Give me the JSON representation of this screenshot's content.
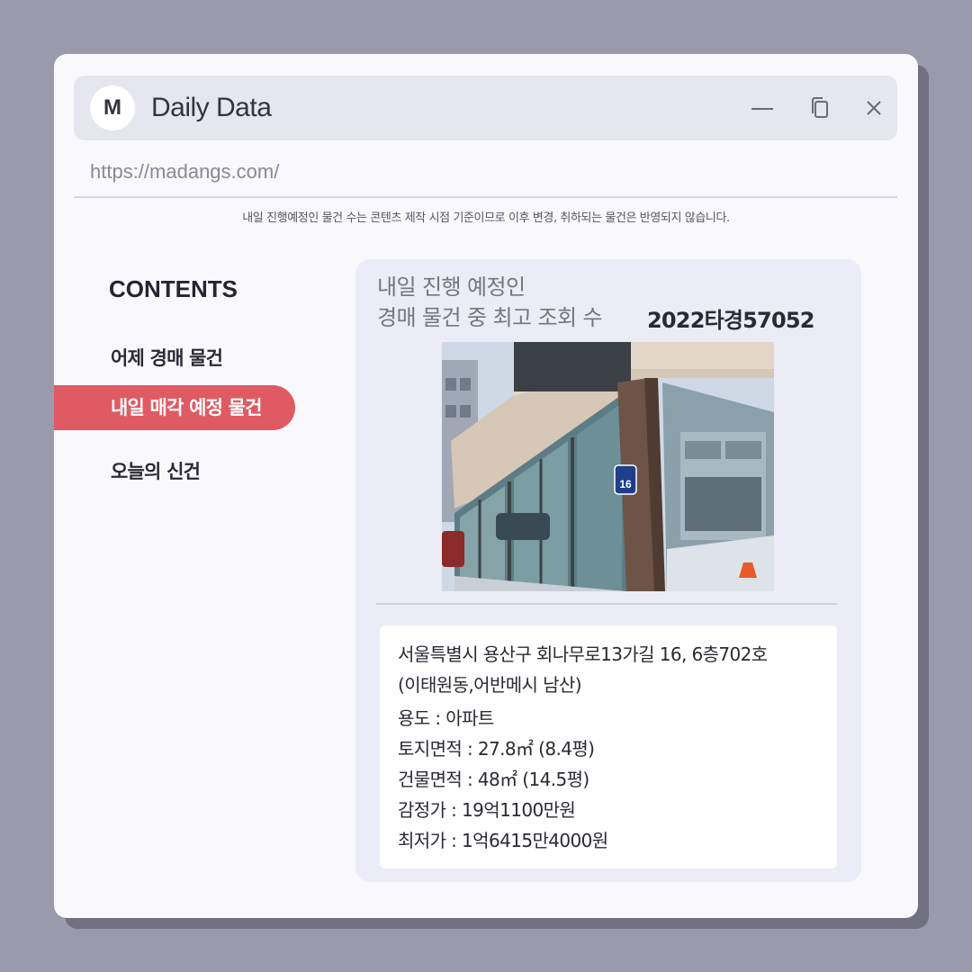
{
  "window": {
    "logo_letter": "M",
    "title": "Daily Data",
    "url": "https://madangs.com/"
  },
  "notice": "내일 진행예정인 물건 수는 콘텐츠 제작 시점 기준이므로 이후 변경, 취하되는 물건은 반영되지 않습니다.",
  "sidebar": {
    "heading": "CONTENTS",
    "items": [
      {
        "label": "어제 경매 물건",
        "active": false
      },
      {
        "label": "내일 매각 예정 물건",
        "active": true
      },
      {
        "label": "오늘의 신건",
        "active": false
      }
    ]
  },
  "card": {
    "heading_line1": "내일 진행 예정인",
    "heading_line2": "경매 물건 중 최고 조회 수",
    "case_number": "2022타경57052",
    "photo_sign_number": "16",
    "address_line1": "서울특별시 용산구 회나무로13가길 16, 6층702호",
    "address_line2": "(이태원동,어반메시 남산)",
    "usage": "용도 : 아파트",
    "land_area": "토지면적 : 27.8㎡ (8.4평)",
    "building_area": "건물면적 : 48㎡ (14.5평)",
    "appraised_price": "감정가 : 19억1100만원",
    "minimum_price": "최저가 : 1억6415만4000원"
  },
  "colors": {
    "background": "#9a9aac",
    "window": "#f8f8fd",
    "titlebar": "#e6e6ef",
    "accent": "#e05a64",
    "card": "#ececf6"
  }
}
